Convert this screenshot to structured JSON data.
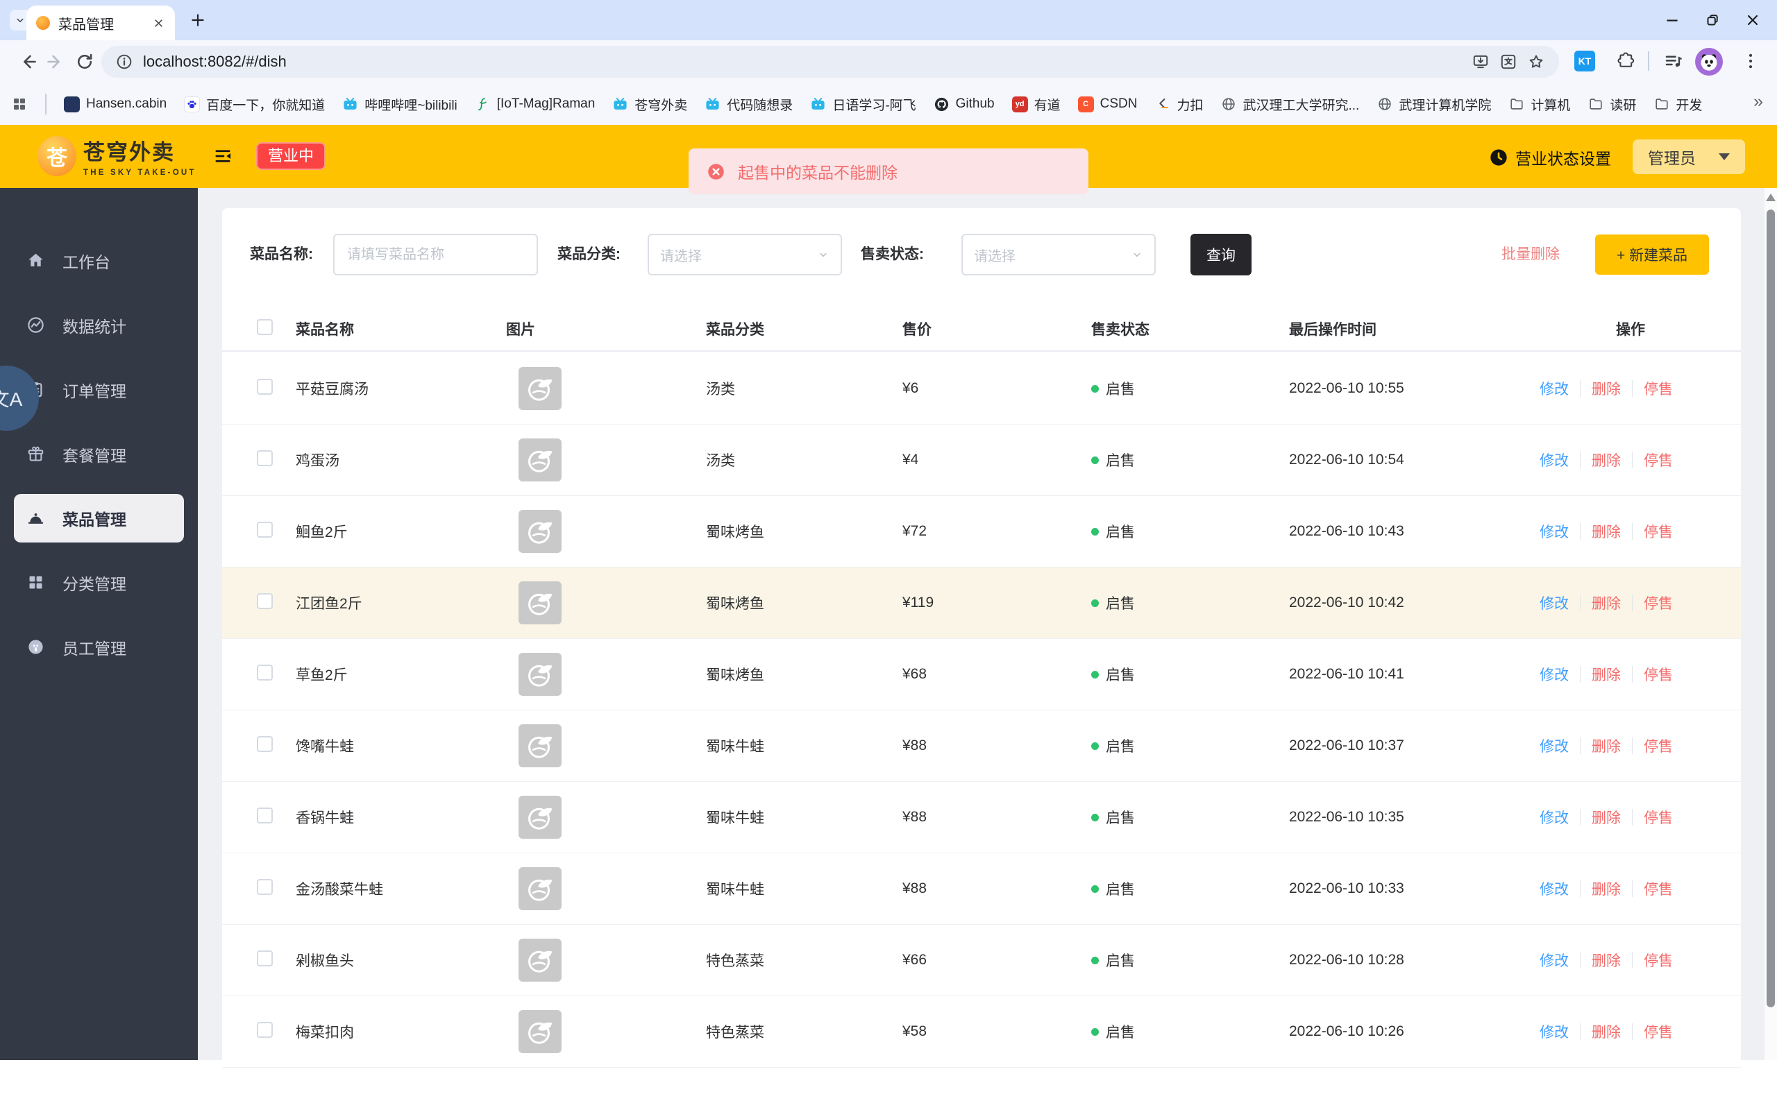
{
  "browser": {
    "tab_title": "菜品管理",
    "url": "localhost:8082/#/dish",
    "overflow_glyph": "»",
    "ext_kt_glyph": "KT",
    "bookmarks": [
      {
        "label": "Hansen.cabin",
        "icon": "site-icon"
      },
      {
        "label": "百度一下，你就知道",
        "icon": "baidu-paw-icon"
      },
      {
        "label": "哔哩哔哩~bilibili",
        "icon": "tv-icon"
      },
      {
        "label": "[IoT-Mag]Raman",
        "icon": "wave-icon"
      },
      {
        "label": "苍穹外卖",
        "icon": "tv-icon"
      },
      {
        "label": "代码随想录",
        "icon": "tv-icon"
      },
      {
        "label": "日语学习-阿飞",
        "icon": "tv-icon"
      },
      {
        "label": "Github",
        "icon": "github-icon"
      },
      {
        "label": "有道",
        "icon": "youdao-icon",
        "glyph": "yd"
      },
      {
        "label": "CSDN",
        "icon": "csdn-icon",
        "glyph": "C"
      },
      {
        "label": "力扣",
        "icon": "leetcode-icon"
      },
      {
        "label": "武汉理工大学研究...",
        "icon": "globe-icon"
      },
      {
        "label": "武理计算机学院",
        "icon": "globe-icon"
      },
      {
        "label": "计算机",
        "icon": "folder-icon"
      },
      {
        "label": "读研",
        "icon": "folder-icon"
      },
      {
        "label": "开发",
        "icon": "folder-icon"
      }
    ]
  },
  "header": {
    "brand_name": "苍穹外卖",
    "brand_sub": "THE SKY TAKE-OUT",
    "logo_glyph": "苍",
    "status_badge": "营业中",
    "status_setting": "营业状态设置",
    "admin_label": "管理员"
  },
  "toast": {
    "message": "起售中的菜品不能删除"
  },
  "float_widget": {
    "label": "文A"
  },
  "sidebar": {
    "items": [
      {
        "label": "工作台",
        "icon": "home-icon"
      },
      {
        "label": "数据统计",
        "icon": "stats-icon"
      },
      {
        "label": "订单管理",
        "icon": "orders-icon"
      },
      {
        "label": "套餐管理",
        "icon": "combo-gift-icon"
      },
      {
        "label": "菜品管理",
        "icon": "dish-cloche-icon",
        "active": true
      },
      {
        "label": "分类管理",
        "icon": "category-grid-icon"
      },
      {
        "label": "员工管理",
        "icon": "staff-icon"
      }
    ]
  },
  "filters": {
    "name_label": "菜品名称:",
    "name_placeholder": "请填写菜品名称",
    "category_label": "菜品分类:",
    "category_placeholder": "请选择",
    "status_label": "售卖状态:",
    "status_placeholder": "请选择",
    "search_label": "查询",
    "batch_delete_label": "批量删除",
    "new_dish_label": "+ 新建菜品"
  },
  "table": {
    "columns": [
      "菜品名称",
      "图片",
      "菜品分类",
      "售价",
      "售卖状态",
      "最后操作时间",
      "操作"
    ],
    "row_actions": [
      "修改",
      "删除",
      "停售"
    ],
    "rows": [
      {
        "name": "平菇豆腐汤",
        "category": "汤类",
        "price": "¥6",
        "status": "启售",
        "time": "2022-06-10 10:55"
      },
      {
        "name": "鸡蛋汤",
        "category": "汤类",
        "price": "¥4",
        "status": "启售",
        "time": "2022-06-10 10:54"
      },
      {
        "name": "鮰鱼2斤",
        "category": "蜀味烤鱼",
        "price": "¥72",
        "status": "启售",
        "time": "2022-06-10 10:43"
      },
      {
        "name": "江团鱼2斤",
        "category": "蜀味烤鱼",
        "price": "¥119",
        "status": "启售",
        "time": "2022-06-10 10:42",
        "highlight": true
      },
      {
        "name": "草鱼2斤",
        "category": "蜀味烤鱼",
        "price": "¥68",
        "status": "启售",
        "time": "2022-06-10 10:41"
      },
      {
        "name": "馋嘴牛蛙",
        "category": "蜀味牛蛙",
        "price": "¥88",
        "status": "启售",
        "time": "2022-06-10 10:37"
      },
      {
        "name": "香锅牛蛙",
        "category": "蜀味牛蛙",
        "price": "¥88",
        "status": "启售",
        "time": "2022-06-10 10:35"
      },
      {
        "name": "金汤酸菜牛蛙",
        "category": "蜀味牛蛙",
        "price": "¥88",
        "status": "启售",
        "time": "2022-06-10 10:33"
      },
      {
        "name": "剁椒鱼头",
        "category": "特色蒸菜",
        "price": "¥66",
        "status": "启售",
        "time": "2022-06-10 10:28"
      },
      {
        "name": "梅菜扣肉",
        "category": "特色蒸菜",
        "price": "¥58",
        "status": "启售",
        "time": "2022-06-10 10:26"
      }
    ]
  },
  "colors": {
    "brand_yellow": "#ffc200",
    "badge_red": "#fb4343",
    "danger_red": "#f56c6c",
    "link_blue": "#409eff",
    "status_green": "#2dc26c",
    "sidebar_dark": "#343946"
  }
}
